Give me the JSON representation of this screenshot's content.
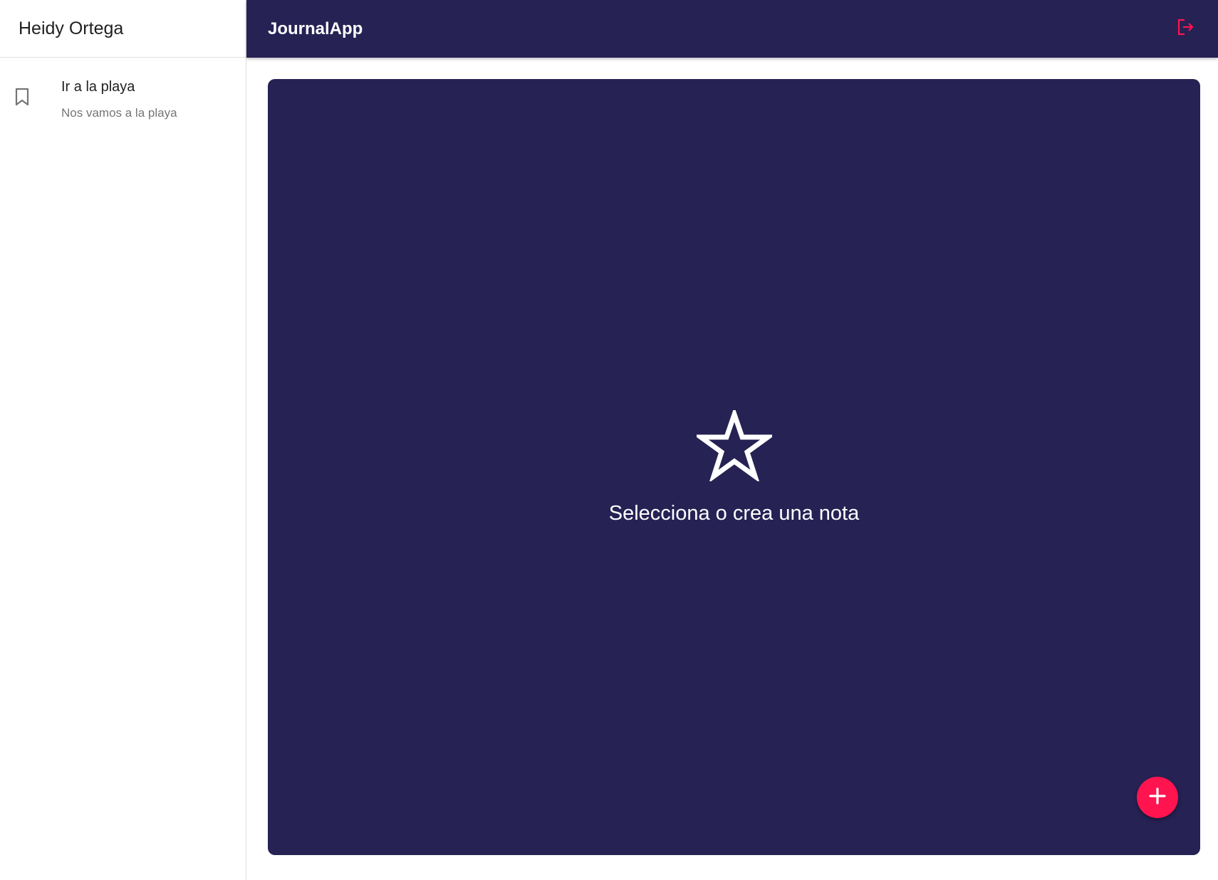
{
  "sidebar": {
    "user_name": "Heidy Ortega",
    "notes": [
      {
        "icon": "bookmark-icon",
        "title": "Ir a la playa",
        "body": "Nos vamos a la playa"
      }
    ]
  },
  "appbar": {
    "title": "JournalApp",
    "logout_icon": "logout-icon"
  },
  "main": {
    "empty_state_icon": "star-icon",
    "empty_state_text": "Selecciona o crea una nota",
    "fab_icon": "add-icon"
  },
  "colors": {
    "primary": "#262254",
    "accent": "#ff1450",
    "background": "#ffffff"
  }
}
